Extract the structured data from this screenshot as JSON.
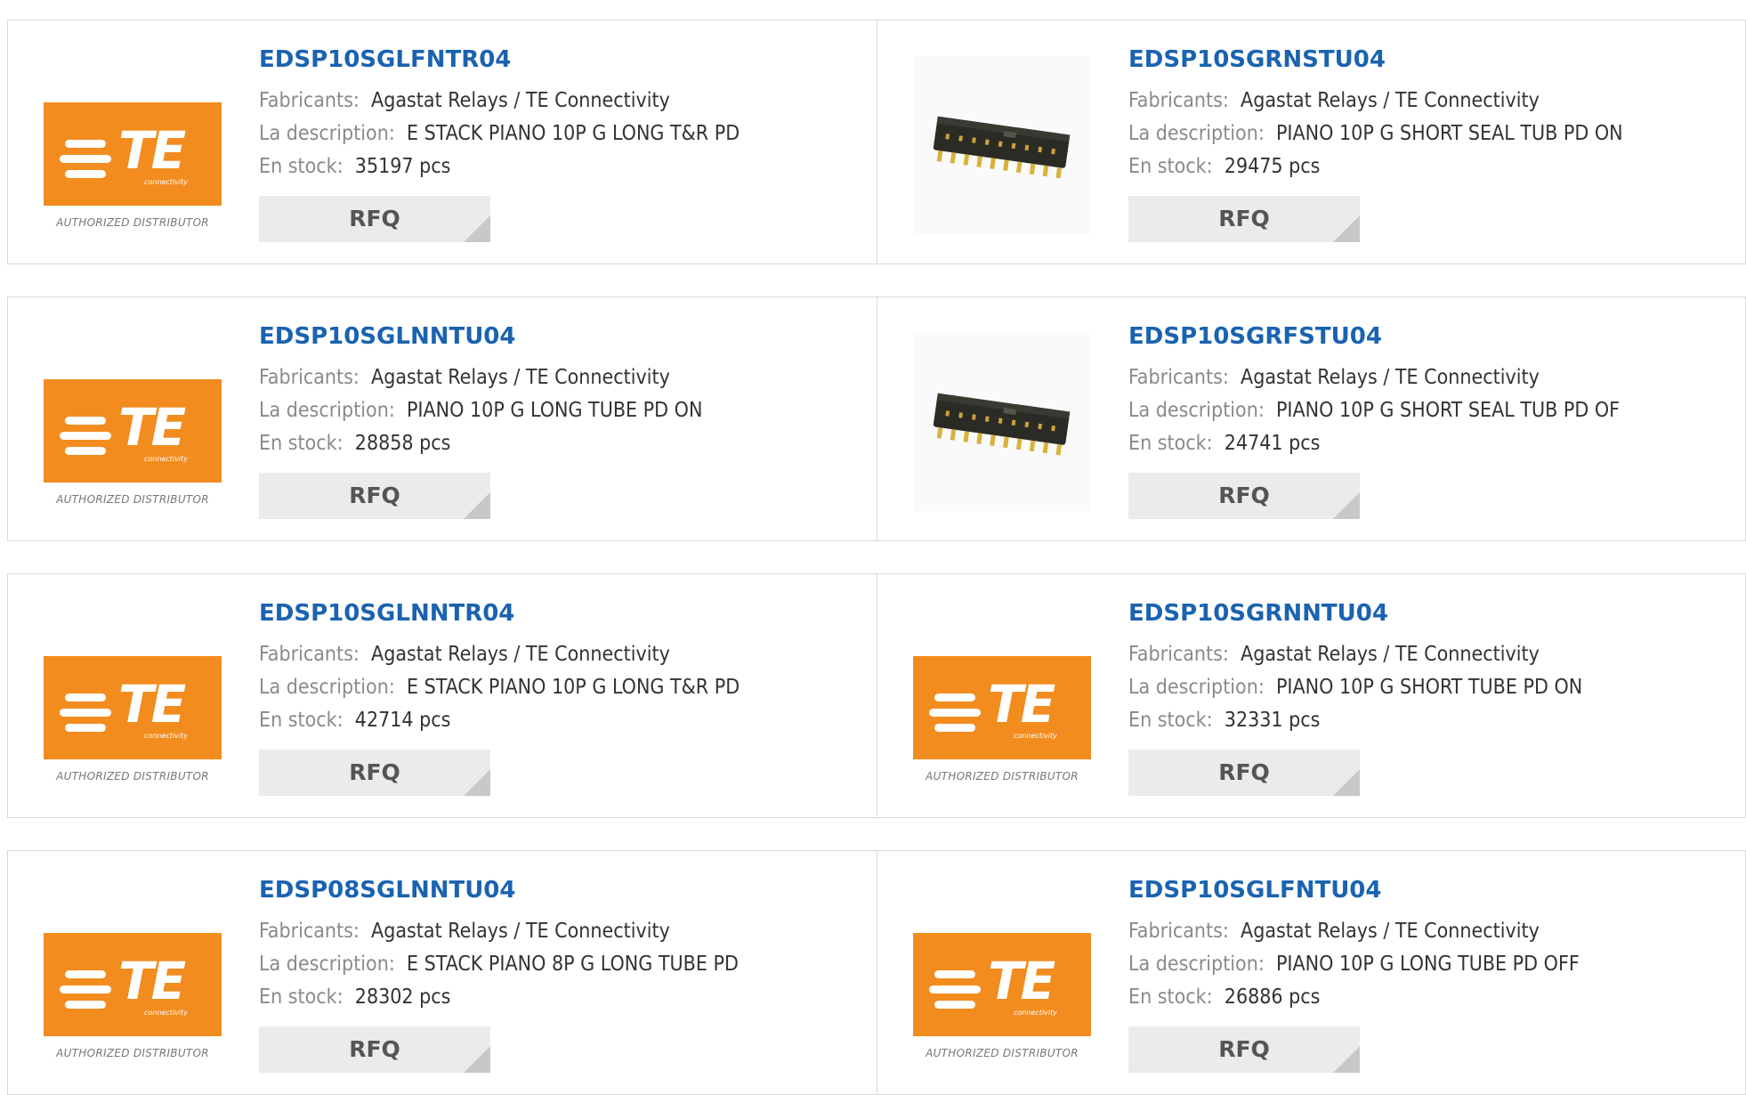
{
  "common": {
    "manufacturer_label": "Fabricants:",
    "description_label": "La description:",
    "stock_label": "En stock:",
    "rfq_label": "RFQ",
    "logo_letters": "TE",
    "logo_subtext": "connectivity",
    "logo_tagline": "AUTHORIZED DISTRIBUTOR"
  },
  "colors": {
    "link": "#1a63b0",
    "brand_orange": "#f28c1e",
    "label_gray": "#8a8a8a",
    "button_bg": "#ebebeb"
  },
  "products": [
    {
      "part": "EDSP10SGLFNTR04",
      "manufacturer": "Agastat Relays / TE Connectivity",
      "description": "E STACK PIANO 10P G LONG T&R PD",
      "stock": "35197 pcs",
      "image": "te-logo"
    },
    {
      "part": "EDSP10SGRNSTU04",
      "manufacturer": "Agastat Relays / TE Connectivity",
      "description": "PIANO 10P G SHORT SEAL TUB PD ON",
      "stock": "29475 pcs",
      "image": "dip-switch-photo"
    },
    {
      "part": "EDSP10SGLNNTU04",
      "manufacturer": "Agastat Relays / TE Connectivity",
      "description": "PIANO 10P G LONG TUBE PD ON",
      "stock": "28858 pcs",
      "image": "te-logo"
    },
    {
      "part": "EDSP10SGRFSTU04",
      "manufacturer": "Agastat Relays / TE Connectivity",
      "description": "PIANO 10P G SHORT SEAL TUB PD OF",
      "stock": "24741 pcs",
      "image": "dip-switch-photo"
    },
    {
      "part": "EDSP10SGLNNTR04",
      "manufacturer": "Agastat Relays / TE Connectivity",
      "description": "E STACK PIANO 10P G LONG T&R PD",
      "stock": "42714 pcs",
      "image": "te-logo"
    },
    {
      "part": "EDSP10SGRNNTU04",
      "manufacturer": "Agastat Relays / TE Connectivity",
      "description": "PIANO 10P G SHORT TUBE PD ON",
      "stock": "32331 pcs",
      "image": "te-logo"
    },
    {
      "part": "EDSP08SGLNNTU04",
      "manufacturer": "Agastat Relays / TE Connectivity",
      "description": "E STACK PIANO 8P G LONG TUBE PD",
      "stock": "28302 pcs",
      "image": "te-logo"
    },
    {
      "part": "EDSP10SGLFNTU04",
      "manufacturer": "Agastat Relays / TE Connectivity",
      "description": "PIANO 10P G LONG TUBE PD OFF",
      "stock": "26886 pcs",
      "image": "te-logo"
    }
  ]
}
